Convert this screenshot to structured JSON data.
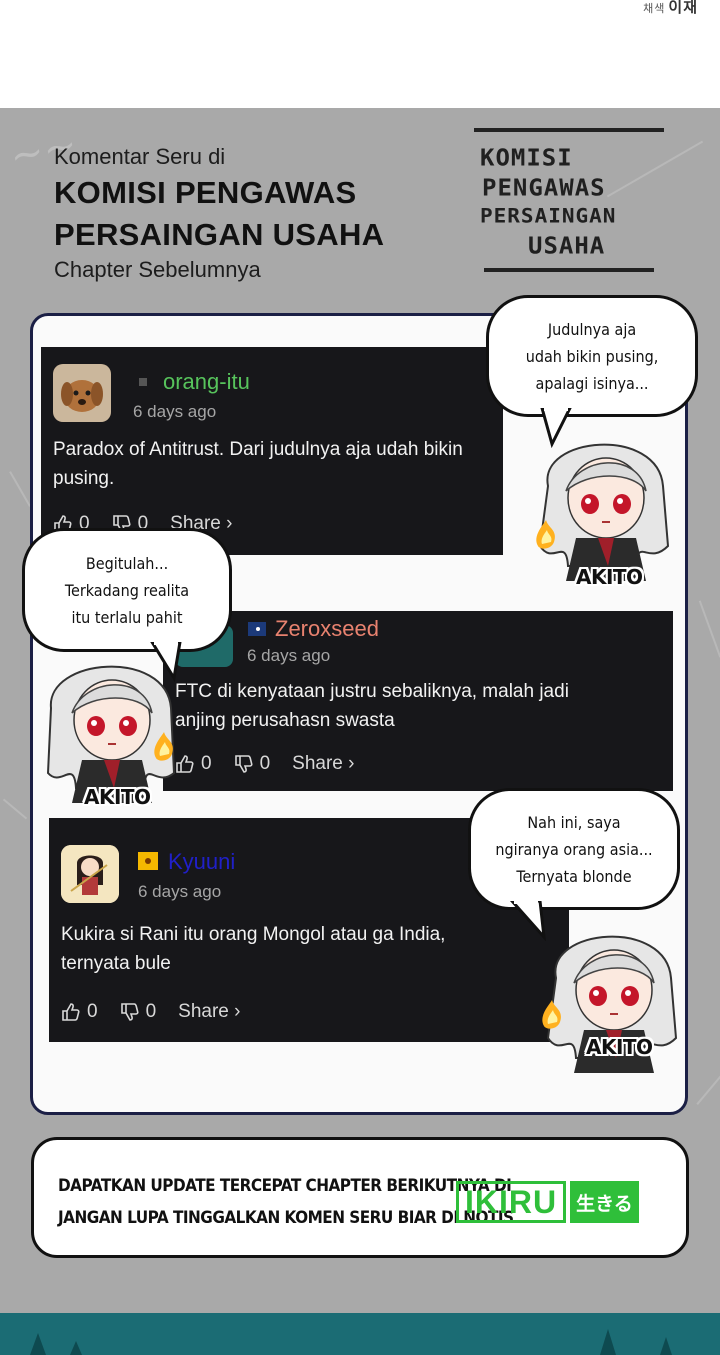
{
  "credit": {
    "small": "채색",
    "main": "이재"
  },
  "heading": {
    "pre": "Komentar Seru di",
    "title_line1": "KOMISI PENGAWAS",
    "title_line2": "PERSAINGAN USAHA",
    "post": "Chapter Sebelumnya"
  },
  "logo": {
    "lines": [
      "KOMISI",
      "PENGAWAS",
      "PERSAINGAN",
      "USAHA"
    ]
  },
  "comments": [
    {
      "username": "orang-itu",
      "username_color": "#57c35c",
      "time": "6 days ago",
      "text_line1": "Paradox of Antitrust. Dari judulnya aja udah bikin",
      "text_line2": "pusing.",
      "likes": "0",
      "dislikes": "0",
      "share": "Share ›"
    },
    {
      "username": "Zeroxseed",
      "username_color": "#e8826f",
      "time": "6 days ago",
      "text_line1": "FTC di kenyataan justru sebaliknya, malah jadi",
      "text_line2": "anjing perusahasn swasta",
      "likes": "0",
      "dislikes": "0",
      "share": "Share ›"
    },
    {
      "username": "Kyuuni",
      "username_color": "#2020c8",
      "time": "6 days ago",
      "text_line1": "Kukira si Rani itu orang Mongol atau ga India,",
      "text_line2": "ternyata bule",
      "likes": "0",
      "dislikes": "0",
      "share": "Share ›"
    }
  ],
  "bubbles": [
    {
      "lines": [
        "Judulnya aja",
        "udah bikin pusing,",
        "apalagi isinya..."
      ]
    },
    {
      "lines": [
        "Begitulah...",
        "Terkadang realita",
        "itu terlalu pahit"
      ]
    },
    {
      "lines": [
        "Nah ini, saya",
        "ngiranya orang asia...",
        "Ternyata blonde"
      ]
    }
  ],
  "character_name": "AKITO",
  "banner": {
    "line1": "DAPATKAN UPDATE TERCEPAT CHAPTER BERIKUTNYA DI",
    "line2": "JANGAN LUPA TINGGALKAN KOMEN SERU BIAR DI NOTIS",
    "brand": "IKIRU",
    "brand_jp": "生きる"
  },
  "colors": {
    "panel": "#a9a9a9",
    "card_border": "#1b1f45",
    "comment_bg": "#17171a",
    "brand_green": "#2fbf3a",
    "bottom_strip": "#1b6c74"
  },
  "icons": [
    "thumbs-up-icon",
    "thumbs-down-icon",
    "flag-icon"
  ]
}
